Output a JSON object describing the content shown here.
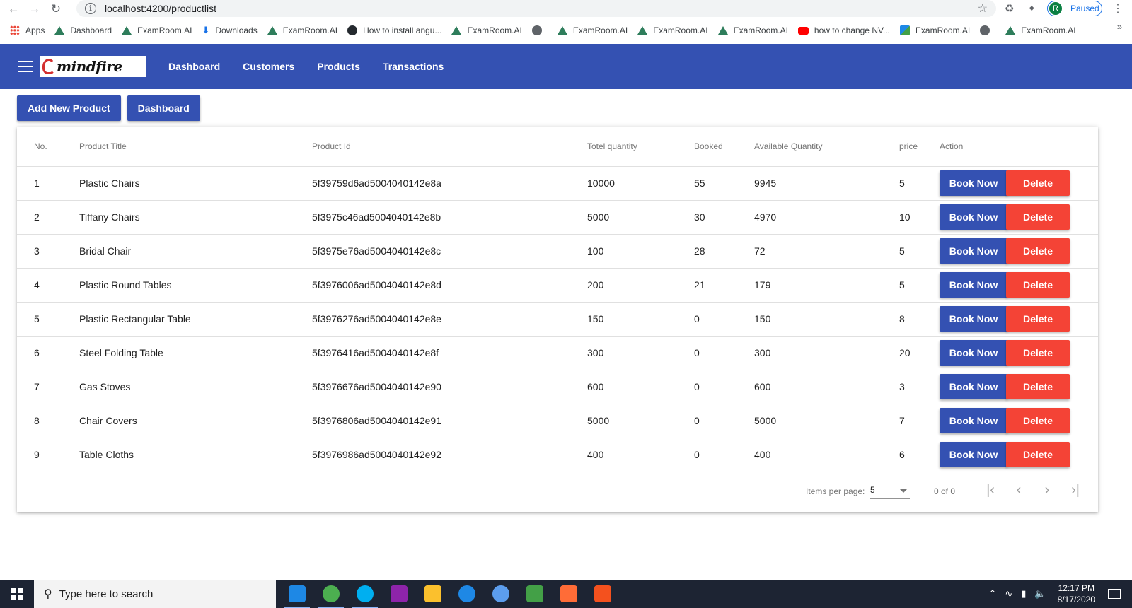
{
  "browser": {
    "url": "localhost:4200/productlist",
    "profile_initial": "R",
    "profile_status": "Paused",
    "bookmarks": [
      {
        "label": "Apps",
        "icon": "apps-grid-icon"
      },
      {
        "label": "Dashboard",
        "icon": "examroom-icon"
      },
      {
        "label": "ExamRoom.AI",
        "icon": "examroom-icon"
      },
      {
        "label": "Downloads",
        "icon": "download-icon"
      },
      {
        "label": "ExamRoom.AI",
        "icon": "examroom-icon"
      },
      {
        "label": "How to install angu...",
        "icon": "github-icon"
      },
      {
        "label": "ExamRoom.AI",
        "icon": "examroom-icon"
      },
      {
        "label": "",
        "icon": "globe-icon"
      },
      {
        "label": "ExamRoom.AI",
        "icon": "examroom-icon"
      },
      {
        "label": "ExamRoom.AI",
        "icon": "examroom-icon"
      },
      {
        "label": "ExamRoom.AI",
        "icon": "examroom-icon"
      },
      {
        "label": "how to change NV...",
        "icon": "youtube-icon"
      },
      {
        "label": "ExamRoom.AI",
        "icon": "image-icon"
      },
      {
        "label": "",
        "icon": "globe-icon"
      },
      {
        "label": "ExamRoom.AI",
        "icon": "examroom-icon"
      }
    ],
    "more_bookmarks": "»"
  },
  "app": {
    "logo_text": "mindfire",
    "nav": [
      "Dashboard",
      "Customers",
      "Products",
      "Transactions"
    ],
    "actions": {
      "add_product": "Add New Product",
      "dashboard": "Dashboard"
    },
    "brand_color": "#3451b2",
    "danger_color": "#f44336"
  },
  "table": {
    "headers": [
      "No.",
      "Product Title",
      "Product Id",
      "Totel quantity",
      "Booked",
      "Available Quantity",
      "price",
      "Action"
    ],
    "book_label": "Book Now",
    "delete_label": "Delete",
    "rows": [
      {
        "no": "1",
        "title": "Plastic Chairs",
        "id": "5f39759d6ad5004040142e8a",
        "total": "10000",
        "booked": "55",
        "available": "9945",
        "price": "5"
      },
      {
        "no": "2",
        "title": "Tiffany Chairs",
        "id": "5f3975c46ad5004040142e8b",
        "total": "5000",
        "booked": "30",
        "available": "4970",
        "price": "10"
      },
      {
        "no": "3",
        "title": "Bridal Chair",
        "id": "5f3975e76ad5004040142e8c",
        "total": "100",
        "booked": "28",
        "available": "72",
        "price": "5"
      },
      {
        "no": "4",
        "title": "Plastic Round Tables",
        "id": "5f3976006ad5004040142e8d",
        "total": "200",
        "booked": "21",
        "available": "179",
        "price": "5"
      },
      {
        "no": "5",
        "title": "Plastic Rectangular Table",
        "id": "5f3976276ad5004040142e8e",
        "total": "150",
        "booked": "0",
        "available": "150",
        "price": "8"
      },
      {
        "no": "6",
        "title": "Steel Folding Table",
        "id": "5f3976416ad5004040142e8f",
        "total": "300",
        "booked": "0",
        "available": "300",
        "price": "20"
      },
      {
        "no": "7",
        "title": "Gas Stoves",
        "id": "5f3976676ad5004040142e90",
        "total": "600",
        "booked": "0",
        "available": "600",
        "price": "3"
      },
      {
        "no": "8",
        "title": "Chair Covers",
        "id": "5f3976806ad5004040142e91",
        "total": "5000",
        "booked": "0",
        "available": "5000",
        "price": "7"
      },
      {
        "no": "9",
        "title": "Table Cloths",
        "id": "5f3976986ad5004040142e92",
        "total": "400",
        "booked": "0",
        "available": "400",
        "price": "6"
      }
    ]
  },
  "paginator": {
    "label": "Items per page:",
    "page_size": "5",
    "range": "0 of 0"
  },
  "taskbar": {
    "search_placeholder": "Type here to search",
    "time": "12:17 PM",
    "date": "8/17/2020",
    "apps": [
      {
        "name": "vscode-icon",
        "color": "#1e88e5"
      },
      {
        "name": "chrome-icon",
        "color": "#4caf50"
      },
      {
        "name": "skype-icon",
        "color": "#00aff0"
      },
      {
        "name": "winrar-icon",
        "color": "#8e24aa"
      },
      {
        "name": "file-explorer-icon",
        "color": "#fbc02d"
      },
      {
        "name": "edge-icon",
        "color": "#1e88e5"
      },
      {
        "name": "chromium-icon",
        "color": "#5c9ded"
      },
      {
        "name": "robo3t-icon",
        "color": "#43a047"
      },
      {
        "name": "postman-icon",
        "color": "#ff6c37"
      },
      {
        "name": "git-icon",
        "color": "#f4511e"
      }
    ]
  }
}
